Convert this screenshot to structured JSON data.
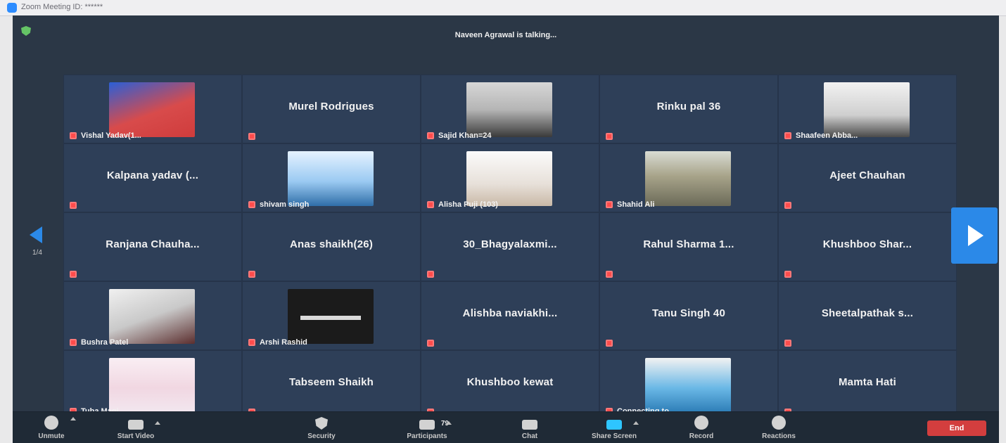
{
  "window": {
    "title": "Zoom Meeting ID: ******"
  },
  "status": {
    "talking": "Naveen Agrawal is talking..."
  },
  "colors": {
    "meeting_bg": "#2b3746",
    "tile_bg": "#2e3f58",
    "toolbar_bg": "#1f2a36",
    "accent_blue": "#2b89e8",
    "mute_red": "#ff4c4c",
    "end_red": "#d33e3e",
    "share_green_blue": "#2ec5ff"
  },
  "grid": {
    "tiles": [
      {
        "name": "Vishal Yadav(1...",
        "has_video": true,
        "video_style": "v1",
        "label_position": "corner"
      },
      {
        "name": "Murel Rodrigues",
        "has_video": false,
        "label_position": "center"
      },
      {
        "name": "Sajid Khan=24",
        "has_video": true,
        "video_style": "v2",
        "label_position": "corner"
      },
      {
        "name": "Rinku pal 36",
        "has_video": false,
        "label_position": "center"
      },
      {
        "name": "Shaafeen Abba...",
        "has_video": true,
        "video_style": "v3",
        "label_position": "corner"
      },
      {
        "name": "Kalpana yadav (...",
        "has_video": false,
        "label_position": "center"
      },
      {
        "name": "shivam singh",
        "has_video": true,
        "video_style": "v4",
        "label_position": "corner"
      },
      {
        "name": "Alisha Puji (103)",
        "has_video": true,
        "video_style": "v5",
        "label_position": "corner"
      },
      {
        "name": "Shahid Ali",
        "has_video": true,
        "video_style": "v6",
        "label_position": "corner"
      },
      {
        "name": "Ajeet Chauhan",
        "has_video": false,
        "label_position": "center"
      },
      {
        "name": "Ranjana Chauha...",
        "has_video": false,
        "label_position": "center"
      },
      {
        "name": "Anas shaikh(26)",
        "has_video": false,
        "label_position": "center"
      },
      {
        "name": "30_Bhagyalaxmi...",
        "has_video": false,
        "label_position": "center"
      },
      {
        "name": "Rahul Sharma 1...",
        "has_video": false,
        "label_position": "center"
      },
      {
        "name": "Khushboo Shar...",
        "has_video": false,
        "label_position": "center"
      },
      {
        "name": "Bushra Patel",
        "has_video": true,
        "video_style": "v7",
        "label_position": "corner"
      },
      {
        "name": "Arshi Rashid",
        "has_video": true,
        "video_style": "v8",
        "label_position": "corner"
      },
      {
        "name": "Alishba naviakhi...",
        "has_video": false,
        "label_position": "center"
      },
      {
        "name": "Tanu Singh 40",
        "has_video": false,
        "label_position": "center"
      },
      {
        "name": "Sheetalpathak s...",
        "has_video": false,
        "label_position": "center"
      },
      {
        "name": "Tuba Maqi",
        "has_video": true,
        "video_style": "v9",
        "label_position": "corner"
      },
      {
        "name": "Tabseem Shaikh",
        "has_video": false,
        "label_position": "center"
      },
      {
        "name": "Khushboo kewat",
        "has_video": false,
        "label_position": "center"
      },
      {
        "name": "Connecting to ...",
        "has_video": true,
        "video_style": "v10",
        "label_position": "corner"
      },
      {
        "name": "Mamta Hati",
        "has_video": false,
        "label_position": "center"
      }
    ]
  },
  "pagination": {
    "left_page_label": "1/4"
  },
  "toolbar": {
    "unmute_label": "Unmute",
    "start_video_label": "Start Video",
    "security_label": "Security",
    "participants_label": "Participants",
    "participants_count": "79",
    "chat_label": "Chat",
    "share_screen_label": "Share Screen",
    "record_label": "Record",
    "reactions_label": "Reactions",
    "end_label": "End"
  },
  "icons": {
    "app_icon": "zoom-icon",
    "meeting_shield_icon": "shield-icon",
    "mute_icon": "muted-mic-icon",
    "prev_page_icon": "chevron-left-icon",
    "next_page_icon": "chevron-right-icon",
    "unmute_icon": "mic-icon",
    "start_video_icon": "camera-icon",
    "security_icon": "shield-icon",
    "participants_icon": "people-icon",
    "chat_icon": "chat-icon",
    "share_icon": "share-screen-icon",
    "record_icon": "record-icon",
    "reactions_icon": "emoji-icon"
  }
}
